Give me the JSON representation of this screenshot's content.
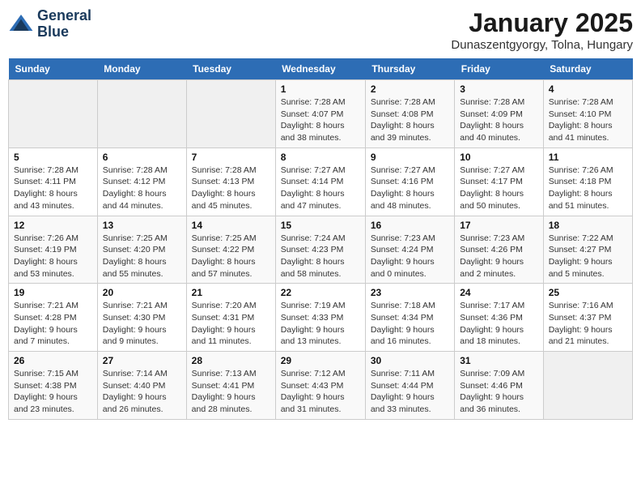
{
  "header": {
    "logo_line1": "General",
    "logo_line2": "Blue",
    "month_title": "January 2025",
    "location": "Dunaszentgyorgy, Tolna, Hungary"
  },
  "weekdays": [
    "Sunday",
    "Monday",
    "Tuesday",
    "Wednesday",
    "Thursday",
    "Friday",
    "Saturday"
  ],
  "weeks": [
    [
      {
        "day": "",
        "info": ""
      },
      {
        "day": "",
        "info": ""
      },
      {
        "day": "",
        "info": ""
      },
      {
        "day": "1",
        "info": "Sunrise: 7:28 AM\nSunset: 4:07 PM\nDaylight: 8 hours\nand 38 minutes."
      },
      {
        "day": "2",
        "info": "Sunrise: 7:28 AM\nSunset: 4:08 PM\nDaylight: 8 hours\nand 39 minutes."
      },
      {
        "day": "3",
        "info": "Sunrise: 7:28 AM\nSunset: 4:09 PM\nDaylight: 8 hours\nand 40 minutes."
      },
      {
        "day": "4",
        "info": "Sunrise: 7:28 AM\nSunset: 4:10 PM\nDaylight: 8 hours\nand 41 minutes."
      }
    ],
    [
      {
        "day": "5",
        "info": "Sunrise: 7:28 AM\nSunset: 4:11 PM\nDaylight: 8 hours\nand 43 minutes."
      },
      {
        "day": "6",
        "info": "Sunrise: 7:28 AM\nSunset: 4:12 PM\nDaylight: 8 hours\nand 44 minutes."
      },
      {
        "day": "7",
        "info": "Sunrise: 7:28 AM\nSunset: 4:13 PM\nDaylight: 8 hours\nand 45 minutes."
      },
      {
        "day": "8",
        "info": "Sunrise: 7:27 AM\nSunset: 4:14 PM\nDaylight: 8 hours\nand 47 minutes."
      },
      {
        "day": "9",
        "info": "Sunrise: 7:27 AM\nSunset: 4:16 PM\nDaylight: 8 hours\nand 48 minutes."
      },
      {
        "day": "10",
        "info": "Sunrise: 7:27 AM\nSunset: 4:17 PM\nDaylight: 8 hours\nand 50 minutes."
      },
      {
        "day": "11",
        "info": "Sunrise: 7:26 AM\nSunset: 4:18 PM\nDaylight: 8 hours\nand 51 minutes."
      }
    ],
    [
      {
        "day": "12",
        "info": "Sunrise: 7:26 AM\nSunset: 4:19 PM\nDaylight: 8 hours\nand 53 minutes."
      },
      {
        "day": "13",
        "info": "Sunrise: 7:25 AM\nSunset: 4:20 PM\nDaylight: 8 hours\nand 55 minutes."
      },
      {
        "day": "14",
        "info": "Sunrise: 7:25 AM\nSunset: 4:22 PM\nDaylight: 8 hours\nand 57 minutes."
      },
      {
        "day": "15",
        "info": "Sunrise: 7:24 AM\nSunset: 4:23 PM\nDaylight: 8 hours\nand 58 minutes."
      },
      {
        "day": "16",
        "info": "Sunrise: 7:23 AM\nSunset: 4:24 PM\nDaylight: 9 hours\nand 0 minutes."
      },
      {
        "day": "17",
        "info": "Sunrise: 7:23 AM\nSunset: 4:26 PM\nDaylight: 9 hours\nand 2 minutes."
      },
      {
        "day": "18",
        "info": "Sunrise: 7:22 AM\nSunset: 4:27 PM\nDaylight: 9 hours\nand 5 minutes."
      }
    ],
    [
      {
        "day": "19",
        "info": "Sunrise: 7:21 AM\nSunset: 4:28 PM\nDaylight: 9 hours\nand 7 minutes."
      },
      {
        "day": "20",
        "info": "Sunrise: 7:21 AM\nSunset: 4:30 PM\nDaylight: 9 hours\nand 9 minutes."
      },
      {
        "day": "21",
        "info": "Sunrise: 7:20 AM\nSunset: 4:31 PM\nDaylight: 9 hours\nand 11 minutes."
      },
      {
        "day": "22",
        "info": "Sunrise: 7:19 AM\nSunset: 4:33 PM\nDaylight: 9 hours\nand 13 minutes."
      },
      {
        "day": "23",
        "info": "Sunrise: 7:18 AM\nSunset: 4:34 PM\nDaylight: 9 hours\nand 16 minutes."
      },
      {
        "day": "24",
        "info": "Sunrise: 7:17 AM\nSunset: 4:36 PM\nDaylight: 9 hours\nand 18 minutes."
      },
      {
        "day": "25",
        "info": "Sunrise: 7:16 AM\nSunset: 4:37 PM\nDaylight: 9 hours\nand 21 minutes."
      }
    ],
    [
      {
        "day": "26",
        "info": "Sunrise: 7:15 AM\nSunset: 4:38 PM\nDaylight: 9 hours\nand 23 minutes."
      },
      {
        "day": "27",
        "info": "Sunrise: 7:14 AM\nSunset: 4:40 PM\nDaylight: 9 hours\nand 26 minutes."
      },
      {
        "day": "28",
        "info": "Sunrise: 7:13 AM\nSunset: 4:41 PM\nDaylight: 9 hours\nand 28 minutes."
      },
      {
        "day": "29",
        "info": "Sunrise: 7:12 AM\nSunset: 4:43 PM\nDaylight: 9 hours\nand 31 minutes."
      },
      {
        "day": "30",
        "info": "Sunrise: 7:11 AM\nSunset: 4:44 PM\nDaylight: 9 hours\nand 33 minutes."
      },
      {
        "day": "31",
        "info": "Sunrise: 7:09 AM\nSunset: 4:46 PM\nDaylight: 9 hours\nand 36 minutes."
      },
      {
        "day": "",
        "info": ""
      }
    ]
  ]
}
